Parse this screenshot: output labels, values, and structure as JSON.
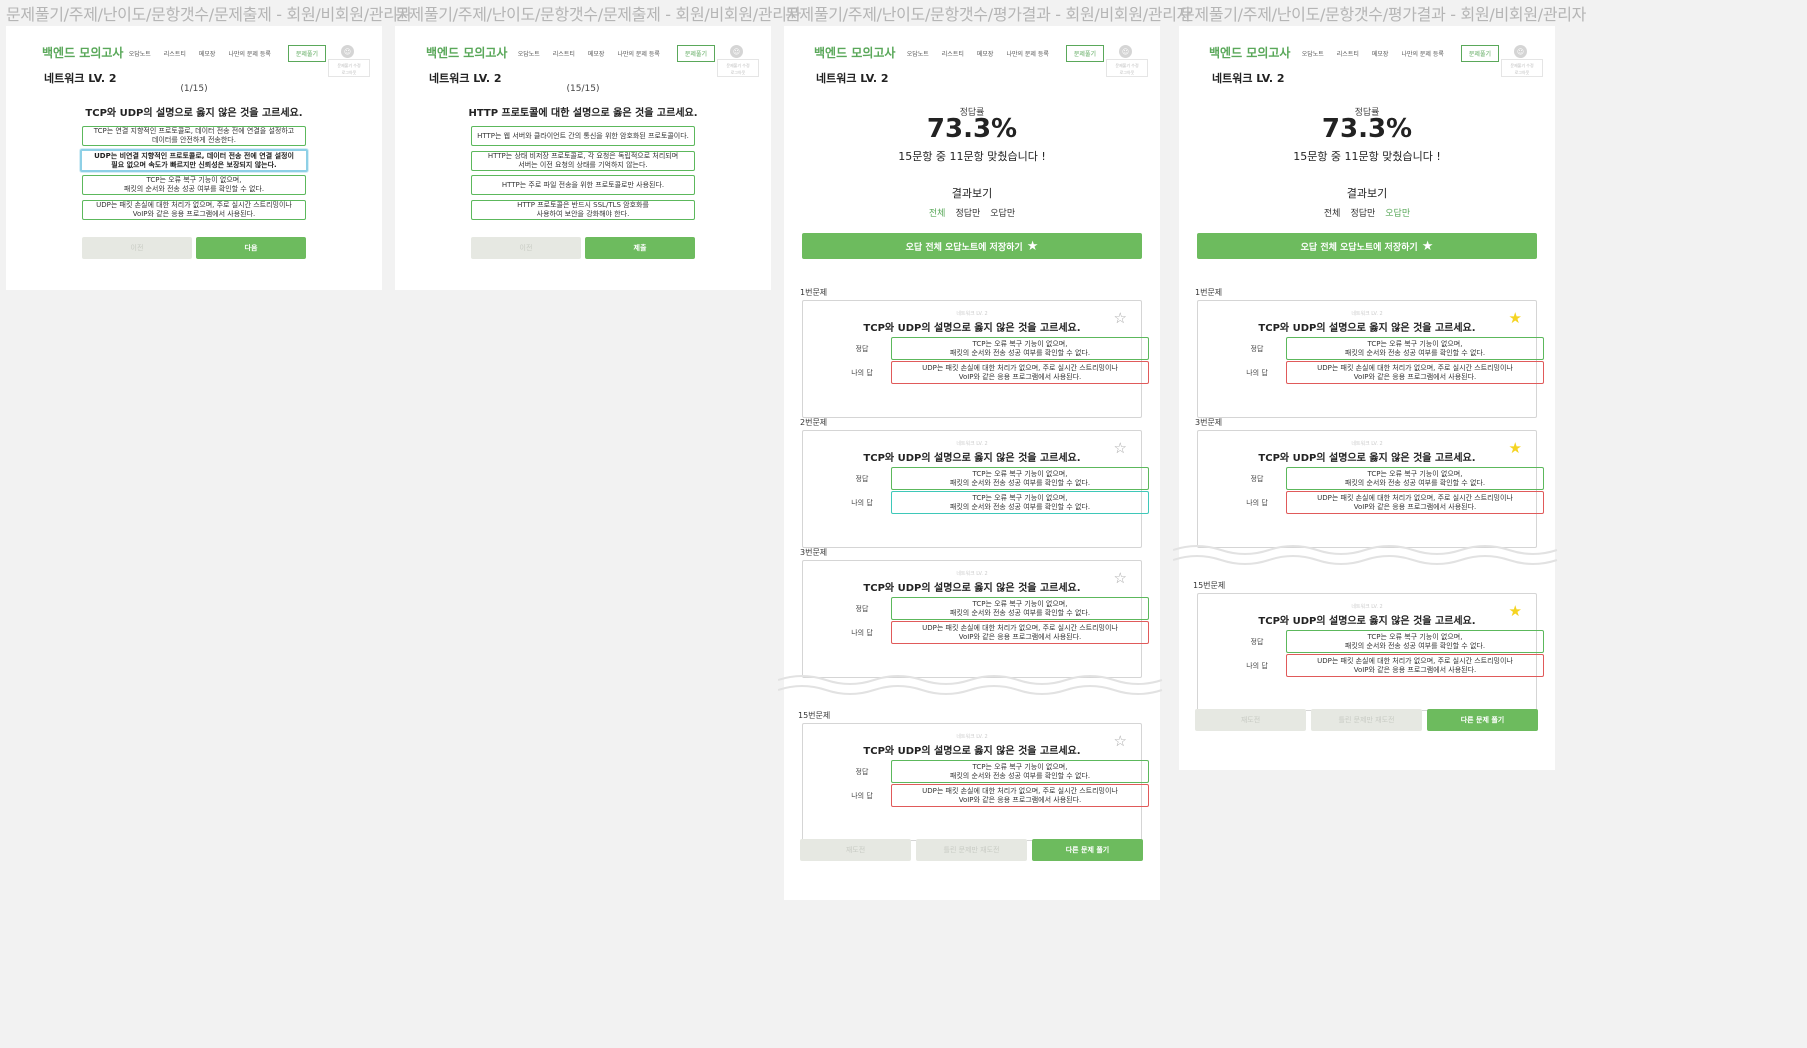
{
  "app_title": "백엔드 모의고사",
  "nav": [
    "오답노트",
    "리스트티",
    "메모장",
    "나만의 문제 등록"
  ],
  "nav_solve": "문제풀기",
  "avatar_glyph": "☺",
  "tooltip": "문제풀기 수정\n로그아웃",
  "set_title": "네트워크 LV. 2",
  "frame_labels": [
    "문제풀기/주제/난이도/문항갯수/문제출제 - 회원/비회원/관리자",
    "문제풀기/주제/난이도/문항갯수/문제출제 - 회원/비회원/관리자",
    "문제풀기/주제/난이도/문항갯수/평가결과 - 회원/비회원/관리자",
    "문제풀기/주제/난이도/문항갯수/평가결과 - 회원/비회원/관리자"
  ],
  "quiz1": {
    "counter": "(1/15)",
    "question": "TCP와 UDP의 설명으로 옳지 않은 것을 고르세요.",
    "options": [
      "TCP는 연결 지향적인 프로토콜로, 데이터 전송 전에 연결을 설정하고\n데이터를 안전하게 전송한다.",
      "UDP는 비연결 지향적인 프로토콜로, 데이터 전송 전에 연결 설정이\n필요 없으며 속도가 빠르지만 신뢰성은 보장되지 않는다.",
      "TCP는 오류 복구 기능이 없으며,\n패킷의 순서와 전송 성공 여부를 확인할 수 없다.",
      "UDP는 패킷 손실에 대한 처리가 없으며, 주로 실시간 스트리밍이나\nVoIP와 같은 응용 프로그램에서 사용된다."
    ],
    "prev": "이전",
    "next": "다음"
  },
  "quiz2": {
    "counter": "(15/15)",
    "question": "HTTP 프로토콜에 대한 설명으로 옳은 것을 고르세요.",
    "options": [
      "HTTP는 웹 서버와 클라이언트 간의 통신을 위한 암호화된 프로토콜이다.",
      "HTTP는 상태 비저장 프로토콜로, 각 요청은 독립적으로 처리되며\n서버는 이전 요청의 상태를 기억하지 않는다.",
      "HTTP는 주로 파일 전송을 위한 프로토콜로만 사용된다.",
      "HTTP 프로토콜은 반드시 SSL/TLS 암호화를\n사용하여 보안을 강화해야 한다."
    ],
    "prev": "이전",
    "submit": "제출"
  },
  "result": {
    "rate_label": "정답률",
    "rate": "73.3%",
    "summary": "15문항 중 11문항 맞췄습니다 !",
    "review_title": "결과보기",
    "filters": [
      "전체",
      "정답만",
      "오답만"
    ],
    "save_all": "오답 전체 오답노트에 저장하기",
    "card_small": "네트워크 LV. 2",
    "correct_label": "정답",
    "my_label": "나의 답",
    "q_text": "TCP와 UDP의 설명으로 옳지 않은 것을 고르세요.",
    "correct_answer": "TCP는 오류 복구 기능이 없으며,\n패킷의 순서와 전송 성공 여부를 확인할 수 없다.",
    "wrong_answer": "UDP는 패킷 손실에 대한 처리가 없으며, 주로 실시간 스트리밍이나\nVoIP와 같은 응용 프로그램에서 사용된다.",
    "q_labels_a": [
      "1번문제",
      "2번문제",
      "3번문제",
      "15번문제"
    ],
    "q_labels_b": [
      "1번문제",
      "3번문제",
      "15번문제"
    ],
    "btn_retry": "재도전",
    "btn_retry_wrong": "틀린 문제만 재도전",
    "btn_other": "다른 문제 풀기"
  },
  "colors": {
    "accent": "#6dbb5e",
    "wrong": "#e05a5a",
    "correct_mine": "#3ec8b9",
    "star_on": "#f5d421"
  }
}
